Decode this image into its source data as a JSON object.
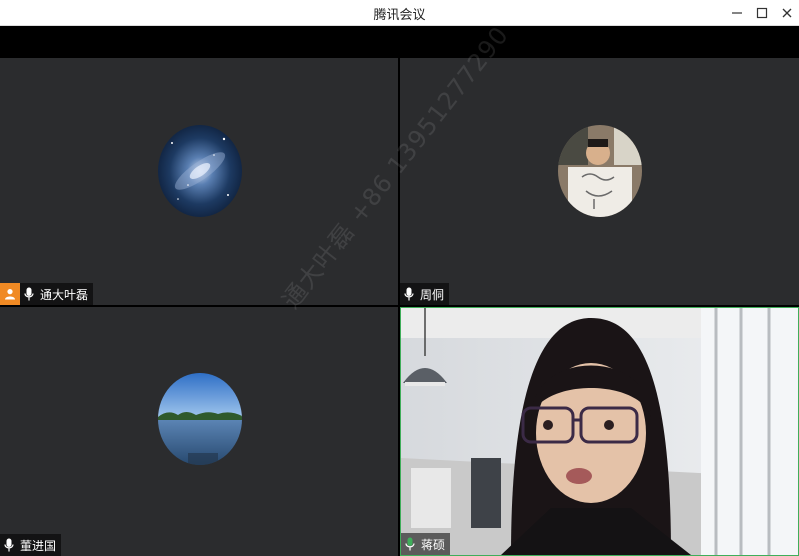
{
  "window": {
    "title": "腾讯会议",
    "controls": [
      "minimize-icon",
      "maximize-icon",
      "close-icon"
    ]
  },
  "participants": [
    {
      "name": "通大叶磊",
      "mic": "mic-icon",
      "is_host": true,
      "avatar": "galaxy"
    },
    {
      "name": "周侗",
      "mic": "mic-icon",
      "is_host": false,
      "avatar": "person-with-drawing"
    },
    {
      "name": "董进国",
      "mic": "mic-icon",
      "is_host": false,
      "avatar": "lake"
    },
    {
      "name": "蒋硕",
      "mic": "mic-icon-speaking",
      "is_host": false,
      "video": true,
      "active_speaker": true
    }
  ],
  "watermark": "通大叶磊 +86 13951277290",
  "colors": {
    "tile_bg": "#2b2c2e",
    "host_badge": "#f08a24",
    "speaking_mic": "#3fae5a",
    "active_border": "#3fae5a"
  }
}
